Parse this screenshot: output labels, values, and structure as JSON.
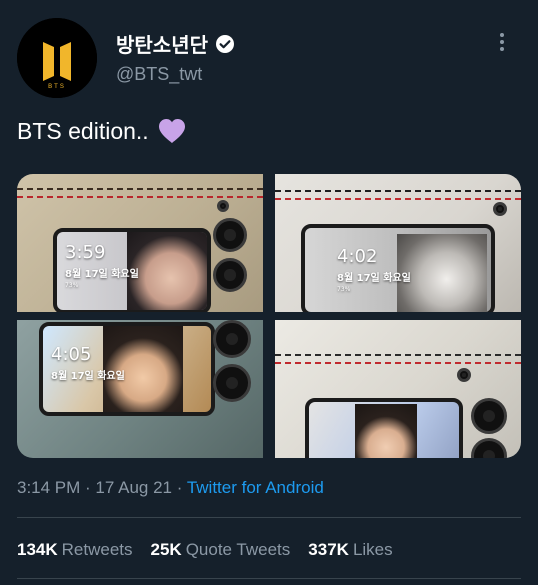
{
  "user": {
    "display_name": "방탄소년단",
    "handle": "@BTS_twt",
    "verified": true,
    "avatar_logo_text": "BTS"
  },
  "tweet": {
    "text": "BTS edition..",
    "emoji": "purple-heart"
  },
  "media": [
    {
      "clock": "3:59",
      "date": "8월 17일 화요일",
      "battery": "73%"
    },
    {
      "clock": "4:02",
      "date": "8월 17일 화요일",
      "battery": "73%"
    },
    {
      "clock": "4:05",
      "date": "8월 17일 화요일",
      "battery": ""
    },
    {
      "clock": "",
      "date": "",
      "battery": ""
    }
  ],
  "meta": {
    "time": "3:14 PM",
    "sep1": " · ",
    "date": "17 Aug 21",
    "sep2": " · ",
    "source": "Twitter for Android"
  },
  "stats": {
    "retweets_count": "134K",
    "retweets_label": "Retweets",
    "quotes_count": "25K",
    "quotes_label": "Quote Tweets",
    "likes_count": "337K",
    "likes_label": "Likes"
  },
  "colors": {
    "background": "#15202b",
    "secondary_text": "#8b98a5",
    "link": "#1d9bf0",
    "divider": "#38444d",
    "heart": "#c8a3e8",
    "logo_gold": "#f1b62b"
  }
}
